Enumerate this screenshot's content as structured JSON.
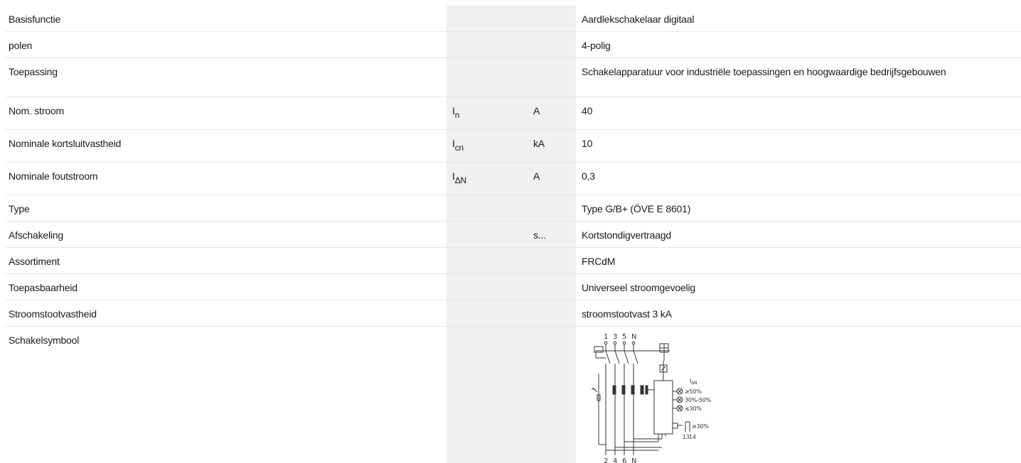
{
  "title_fragment": "",
  "rows": [
    {
      "name": "Basisfunctie",
      "sym": "",
      "sym_sub": "",
      "unit": "",
      "value": "Aardlekschakelaar digitaal"
    },
    {
      "name": "polen",
      "sym": "",
      "sym_sub": "",
      "unit": "",
      "value": "4-polig"
    },
    {
      "name": "Toepassing",
      "sym": "",
      "sym_sub": "",
      "unit": "",
      "value": "Schakelapparatuur voor industriële toepassingen en hoogwaardige bedrijfsgebouwen"
    },
    {
      "name": "Nom. stroom",
      "sym": "I",
      "sym_sub": "n",
      "unit": "A",
      "value": "40"
    },
    {
      "name": "Nominale kortsluitvastheid",
      "sym": "I",
      "sym_sub": "cn",
      "unit": "kA",
      "value": "10"
    },
    {
      "name": "Nominale foutstroom",
      "sym": "I",
      "sym_sub": "ΔN",
      "unit": "A",
      "value": "0,3"
    },
    {
      "name": "Type",
      "sym": "",
      "sym_sub": "",
      "unit": "",
      "value": "Type G/B+ (ÖVE E 8601)"
    },
    {
      "name": "Afschakeling",
      "sym": "",
      "sym_sub": "",
      "unit": "s...",
      "value": "Kortstondigvertraagd"
    },
    {
      "name": "Assortiment",
      "sym": "",
      "sym_sub": "",
      "unit": "",
      "value": "FRCdM"
    },
    {
      "name": "Toepasbaarheid",
      "sym": "",
      "sym_sub": "",
      "unit": "",
      "value": "Universeel stroomgevoelig"
    },
    {
      "name": "Stroomstootvastheid",
      "sym": "",
      "sym_sub": "",
      "unit": "",
      "value": "stroomstootvast 3 kA"
    },
    {
      "name": "Schakelsymbool",
      "sym": "",
      "sym_sub": "",
      "unit": "",
      "value": ""
    }
  ],
  "schematic": {
    "top_terminals": [
      "1",
      "3",
      "5",
      "N"
    ],
    "bottom_terminals": [
      "2",
      "4",
      "6",
      "N"
    ],
    "delta_label": "I",
    "delta_sub": "ΔN",
    "led_labels": [
      "≥50%",
      "30%-50%",
      "≤30%"
    ],
    "contact_label": "≥30%",
    "contact_terminals": [
      "13",
      "14"
    ]
  }
}
